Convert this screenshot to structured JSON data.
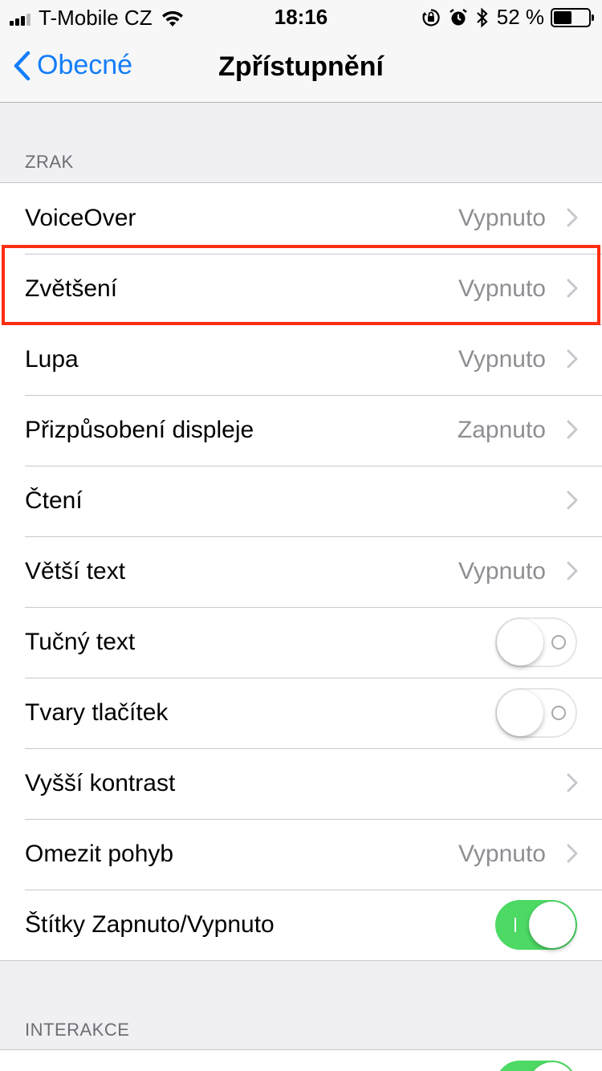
{
  "status_bar": {
    "carrier": "T-Mobile CZ",
    "time": "18:16",
    "battery_percent": "52 %",
    "battery_level": 0.52,
    "icons": [
      "signal-icon",
      "wifi-icon",
      "orientation-lock-icon",
      "alarm-icon",
      "bluetooth-icon",
      "battery-icon"
    ]
  },
  "nav": {
    "back_label": "Obecné",
    "title": "Zpřístupnění"
  },
  "sections": {
    "vision_header": "ZRAK",
    "interaction_header": "INTERAKCE"
  },
  "vision_rows": [
    {
      "label": "VoiceOver",
      "value": "Vypnuto",
      "type": "disclosure"
    },
    {
      "label": "Zvětšení",
      "value": "Vypnuto",
      "type": "disclosure",
      "highlighted": true
    },
    {
      "label": "Lupa",
      "value": "Vypnuto",
      "type": "disclosure"
    },
    {
      "label": "Přizpůsobení displeje",
      "value": "Zapnuto",
      "type": "disclosure"
    },
    {
      "label": "Čtení",
      "value": "",
      "type": "disclosure"
    },
    {
      "label": "Větší text",
      "value": "Vypnuto",
      "type": "disclosure"
    },
    {
      "label": "Tučný text",
      "type": "toggle",
      "on": false
    },
    {
      "label": "Tvary tlačítek",
      "type": "toggle",
      "on": false
    },
    {
      "label": "Vyšší kontrast",
      "value": "",
      "type": "disclosure"
    },
    {
      "label": "Omezit pohyb",
      "value": "Vypnuto",
      "type": "disclosure"
    },
    {
      "label": "Štítky Zapnuto/Vypnuto",
      "type": "toggle",
      "on": true
    }
  ],
  "colors": {
    "accent": "#147efb",
    "toggle_on": "#4cd964",
    "highlight": "#ff2d12",
    "background": "#efeff4"
  }
}
